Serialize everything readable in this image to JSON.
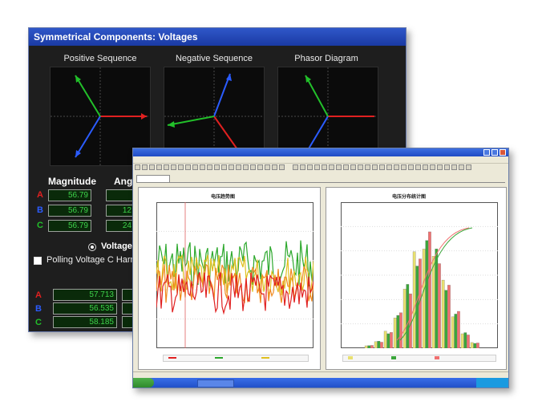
{
  "back_window": {
    "title": "Symmetrical Components: Voltages",
    "plots": [
      {
        "title": "Positive Sequence"
      },
      {
        "title": "Negative Sequence"
      },
      {
        "title": "Phasor Diagram"
      }
    ],
    "table": {
      "col_magnitude": "Magnitude",
      "col_angle": "Ang",
      "rows": [
        {
          "phase": "A",
          "magnitude": "56.79",
          "angle": ""
        },
        {
          "phase": "B",
          "magnitude": "56.79",
          "angle": "12"
        },
        {
          "phase": "C",
          "magnitude": "56.79",
          "angle": "24"
        }
      ]
    },
    "radio_label": "Voltage",
    "checkbox_label": "Polling Voltage C Harmo",
    "bottom_rows": [
      {
        "phase": "A",
        "value": "57.713"
      },
      {
        "phase": "B",
        "value": "56.535"
      },
      {
        "phase": "C",
        "value": "58.185"
      }
    ],
    "colors": {
      "phase_a": "#e02020",
      "phase_b": "#2b5cff",
      "phase_c": "#22c02a"
    }
  },
  "front_window": {
    "chart_left": {
      "title": "电压趋势图"
    },
    "chart_right": {
      "title": "电压分布统计图"
    }
  }
}
